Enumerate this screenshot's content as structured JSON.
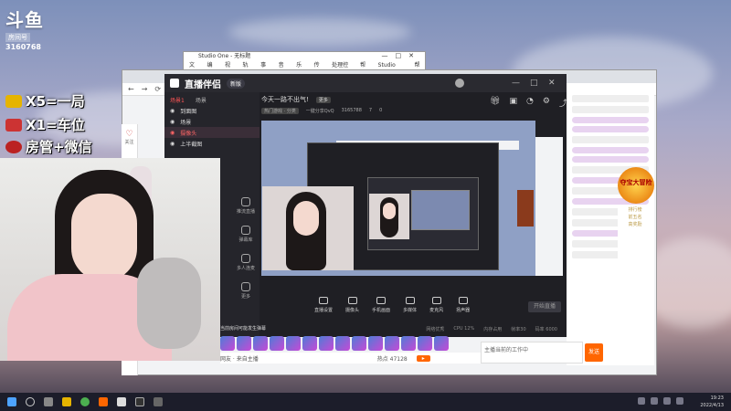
{
  "overlay": {
    "logo_text": "斗鱼",
    "logo_sub": "房间号",
    "room_id": "3160768",
    "promos": [
      "X5=一局",
      "X1=车位",
      "房管+微信"
    ]
  },
  "notepad": {
    "title": "Studio One - 无标题",
    "menu": [
      "文件",
      "编辑",
      "视图",
      "轨道",
      "事件",
      "音频",
      "乐器",
      "传输",
      "处理控制",
      "帮助",
      "Studio One",
      "帮助"
    ]
  },
  "browser": {
    "sidebar_label": "关注",
    "gift_badge": "夺宝大冒险",
    "rank_lines": [
      "排行榜",
      "前五名",
      "高奖励"
    ],
    "chat_text": "主播当前的工作中",
    "send_label": "发送"
  },
  "obs": {
    "app_name": "直播伴侣",
    "version_tag": "新版",
    "window_buttons": [
      "—",
      "□",
      "✕"
    ],
    "scene_tabs": [
      "场景1",
      "场景"
    ],
    "scene_items": [
      "到面图",
      "场景",
      "摄像头",
      "上半截图"
    ],
    "tools": [
      "推流直播",
      "弹幕库",
      "多人连麦",
      "更多"
    ],
    "stream_title": "今天一路不出气!",
    "stream_tag": "更多",
    "meta": [
      "热门游戏 · 分类",
      "一键分享QvQ",
      "3165788",
      "7",
      "0"
    ],
    "controls": [
      "直播设置",
      "摄像头",
      "手机画面",
      "多媒体",
      "麦克风",
      "扬声器"
    ],
    "start_label": "开始直播",
    "status": [
      "网络优秀",
      "CPU 12%",
      "内存占用",
      "帧率30",
      "码率 6000"
    ],
    "bottom_left": "当前房间可能发生弹幕",
    "chat_user": "网友 · 来自主播",
    "chat_count": "热点 47128"
  },
  "taskbar": {
    "time": "19:23",
    "date": "2022/4/13"
  },
  "colors": {
    "accent_red": "#ff4d4f",
    "obs_bg": "#1f1f24",
    "taskbar": "#1c1d2a"
  }
}
